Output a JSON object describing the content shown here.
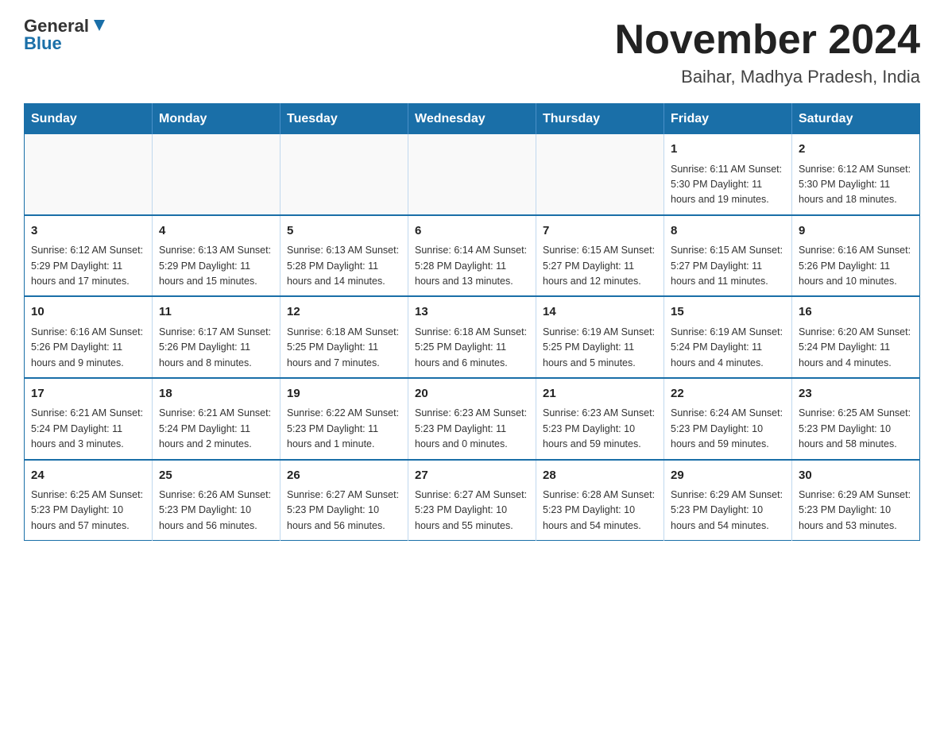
{
  "logo": {
    "part1": "General",
    "part2": "Blue"
  },
  "title": "November 2024",
  "location": "Baihar, Madhya Pradesh, India",
  "days_of_week": [
    "Sunday",
    "Monday",
    "Tuesday",
    "Wednesday",
    "Thursday",
    "Friday",
    "Saturday"
  ],
  "weeks": [
    [
      {
        "day": "",
        "info": ""
      },
      {
        "day": "",
        "info": ""
      },
      {
        "day": "",
        "info": ""
      },
      {
        "day": "",
        "info": ""
      },
      {
        "day": "",
        "info": ""
      },
      {
        "day": "1",
        "info": "Sunrise: 6:11 AM\nSunset: 5:30 PM\nDaylight: 11 hours\nand 19 minutes."
      },
      {
        "day": "2",
        "info": "Sunrise: 6:12 AM\nSunset: 5:30 PM\nDaylight: 11 hours\nand 18 minutes."
      }
    ],
    [
      {
        "day": "3",
        "info": "Sunrise: 6:12 AM\nSunset: 5:29 PM\nDaylight: 11 hours\nand 17 minutes."
      },
      {
        "day": "4",
        "info": "Sunrise: 6:13 AM\nSunset: 5:29 PM\nDaylight: 11 hours\nand 15 minutes."
      },
      {
        "day": "5",
        "info": "Sunrise: 6:13 AM\nSunset: 5:28 PM\nDaylight: 11 hours\nand 14 minutes."
      },
      {
        "day": "6",
        "info": "Sunrise: 6:14 AM\nSunset: 5:28 PM\nDaylight: 11 hours\nand 13 minutes."
      },
      {
        "day": "7",
        "info": "Sunrise: 6:15 AM\nSunset: 5:27 PM\nDaylight: 11 hours\nand 12 minutes."
      },
      {
        "day": "8",
        "info": "Sunrise: 6:15 AM\nSunset: 5:27 PM\nDaylight: 11 hours\nand 11 minutes."
      },
      {
        "day": "9",
        "info": "Sunrise: 6:16 AM\nSunset: 5:26 PM\nDaylight: 11 hours\nand 10 minutes."
      }
    ],
    [
      {
        "day": "10",
        "info": "Sunrise: 6:16 AM\nSunset: 5:26 PM\nDaylight: 11 hours\nand 9 minutes."
      },
      {
        "day": "11",
        "info": "Sunrise: 6:17 AM\nSunset: 5:26 PM\nDaylight: 11 hours\nand 8 minutes."
      },
      {
        "day": "12",
        "info": "Sunrise: 6:18 AM\nSunset: 5:25 PM\nDaylight: 11 hours\nand 7 minutes."
      },
      {
        "day": "13",
        "info": "Sunrise: 6:18 AM\nSunset: 5:25 PM\nDaylight: 11 hours\nand 6 minutes."
      },
      {
        "day": "14",
        "info": "Sunrise: 6:19 AM\nSunset: 5:25 PM\nDaylight: 11 hours\nand 5 minutes."
      },
      {
        "day": "15",
        "info": "Sunrise: 6:19 AM\nSunset: 5:24 PM\nDaylight: 11 hours\nand 4 minutes."
      },
      {
        "day": "16",
        "info": "Sunrise: 6:20 AM\nSunset: 5:24 PM\nDaylight: 11 hours\nand 4 minutes."
      }
    ],
    [
      {
        "day": "17",
        "info": "Sunrise: 6:21 AM\nSunset: 5:24 PM\nDaylight: 11 hours\nand 3 minutes."
      },
      {
        "day": "18",
        "info": "Sunrise: 6:21 AM\nSunset: 5:24 PM\nDaylight: 11 hours\nand 2 minutes."
      },
      {
        "day": "19",
        "info": "Sunrise: 6:22 AM\nSunset: 5:23 PM\nDaylight: 11 hours\nand 1 minute."
      },
      {
        "day": "20",
        "info": "Sunrise: 6:23 AM\nSunset: 5:23 PM\nDaylight: 11 hours\nand 0 minutes."
      },
      {
        "day": "21",
        "info": "Sunrise: 6:23 AM\nSunset: 5:23 PM\nDaylight: 10 hours\nand 59 minutes."
      },
      {
        "day": "22",
        "info": "Sunrise: 6:24 AM\nSunset: 5:23 PM\nDaylight: 10 hours\nand 59 minutes."
      },
      {
        "day": "23",
        "info": "Sunrise: 6:25 AM\nSunset: 5:23 PM\nDaylight: 10 hours\nand 58 minutes."
      }
    ],
    [
      {
        "day": "24",
        "info": "Sunrise: 6:25 AM\nSunset: 5:23 PM\nDaylight: 10 hours\nand 57 minutes."
      },
      {
        "day": "25",
        "info": "Sunrise: 6:26 AM\nSunset: 5:23 PM\nDaylight: 10 hours\nand 56 minutes."
      },
      {
        "day": "26",
        "info": "Sunrise: 6:27 AM\nSunset: 5:23 PM\nDaylight: 10 hours\nand 56 minutes."
      },
      {
        "day": "27",
        "info": "Sunrise: 6:27 AM\nSunset: 5:23 PM\nDaylight: 10 hours\nand 55 minutes."
      },
      {
        "day": "28",
        "info": "Sunrise: 6:28 AM\nSunset: 5:23 PM\nDaylight: 10 hours\nand 54 minutes."
      },
      {
        "day": "29",
        "info": "Sunrise: 6:29 AM\nSunset: 5:23 PM\nDaylight: 10 hours\nand 54 minutes."
      },
      {
        "day": "30",
        "info": "Sunrise: 6:29 AM\nSunset: 5:23 PM\nDaylight: 10 hours\nand 53 minutes."
      }
    ]
  ]
}
